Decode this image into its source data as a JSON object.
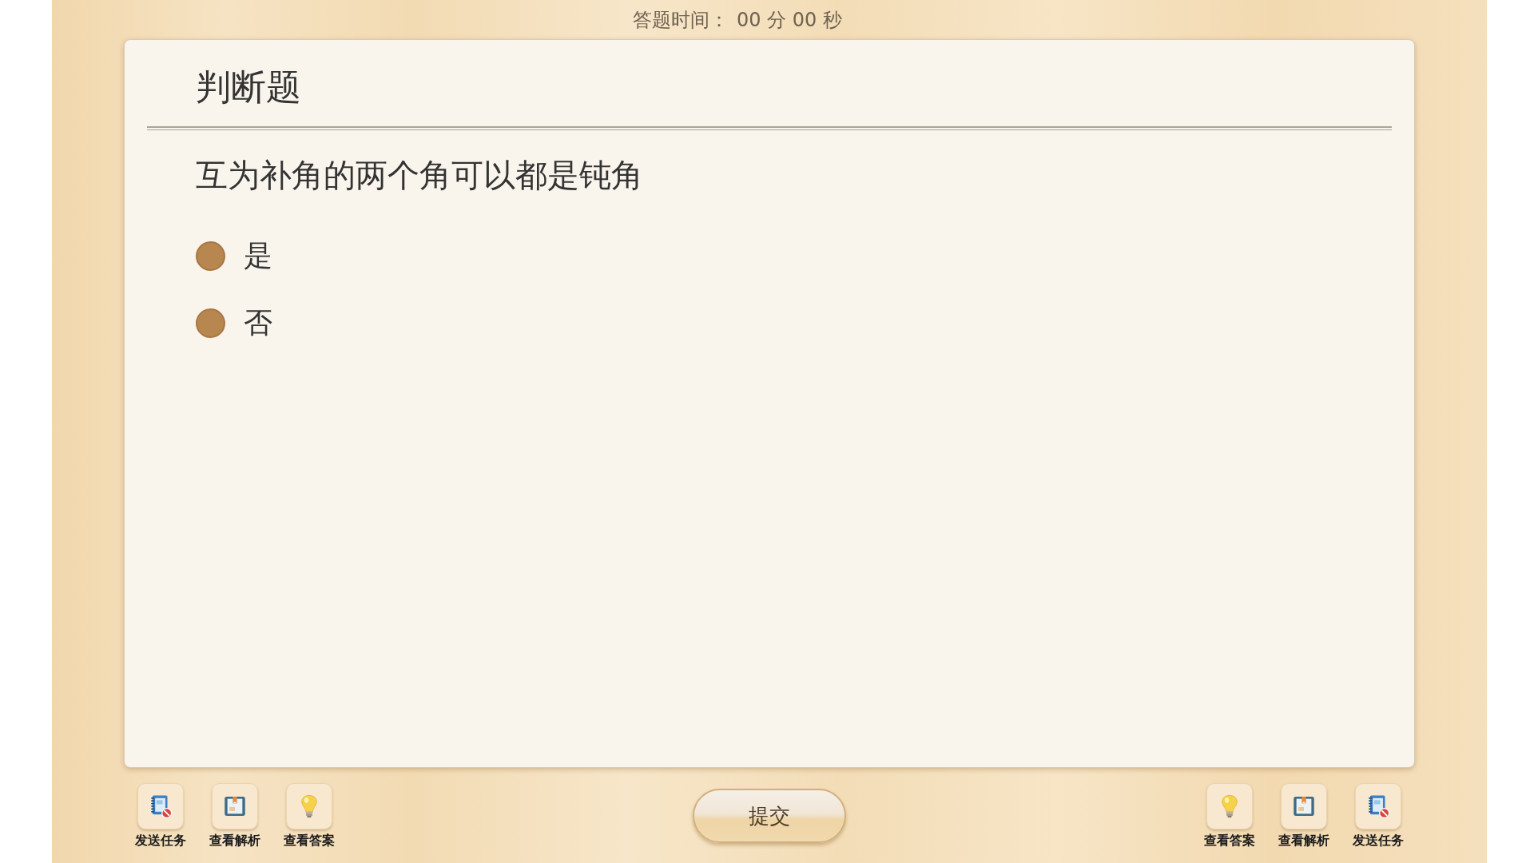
{
  "timer": {
    "label": "答题时间：",
    "value": "00 分 00 秒"
  },
  "question": {
    "type": "判断题",
    "text": "互为补角的两个角可以都是钝角",
    "options": [
      {
        "label": "是",
        "selected": false
      },
      {
        "label": "否",
        "selected": false
      }
    ]
  },
  "toolbar_left": [
    {
      "kind": "task",
      "label": "发送任务"
    },
    {
      "kind": "analysis",
      "label": "查看解析"
    },
    {
      "kind": "answer",
      "label": "查看答案"
    }
  ],
  "submit_button": "提交",
  "toolbar_right": [
    {
      "kind": "answer",
      "label": "查看答案"
    },
    {
      "kind": "analysis",
      "label": "查看解析"
    },
    {
      "kind": "task",
      "label": "发送任务"
    }
  ]
}
